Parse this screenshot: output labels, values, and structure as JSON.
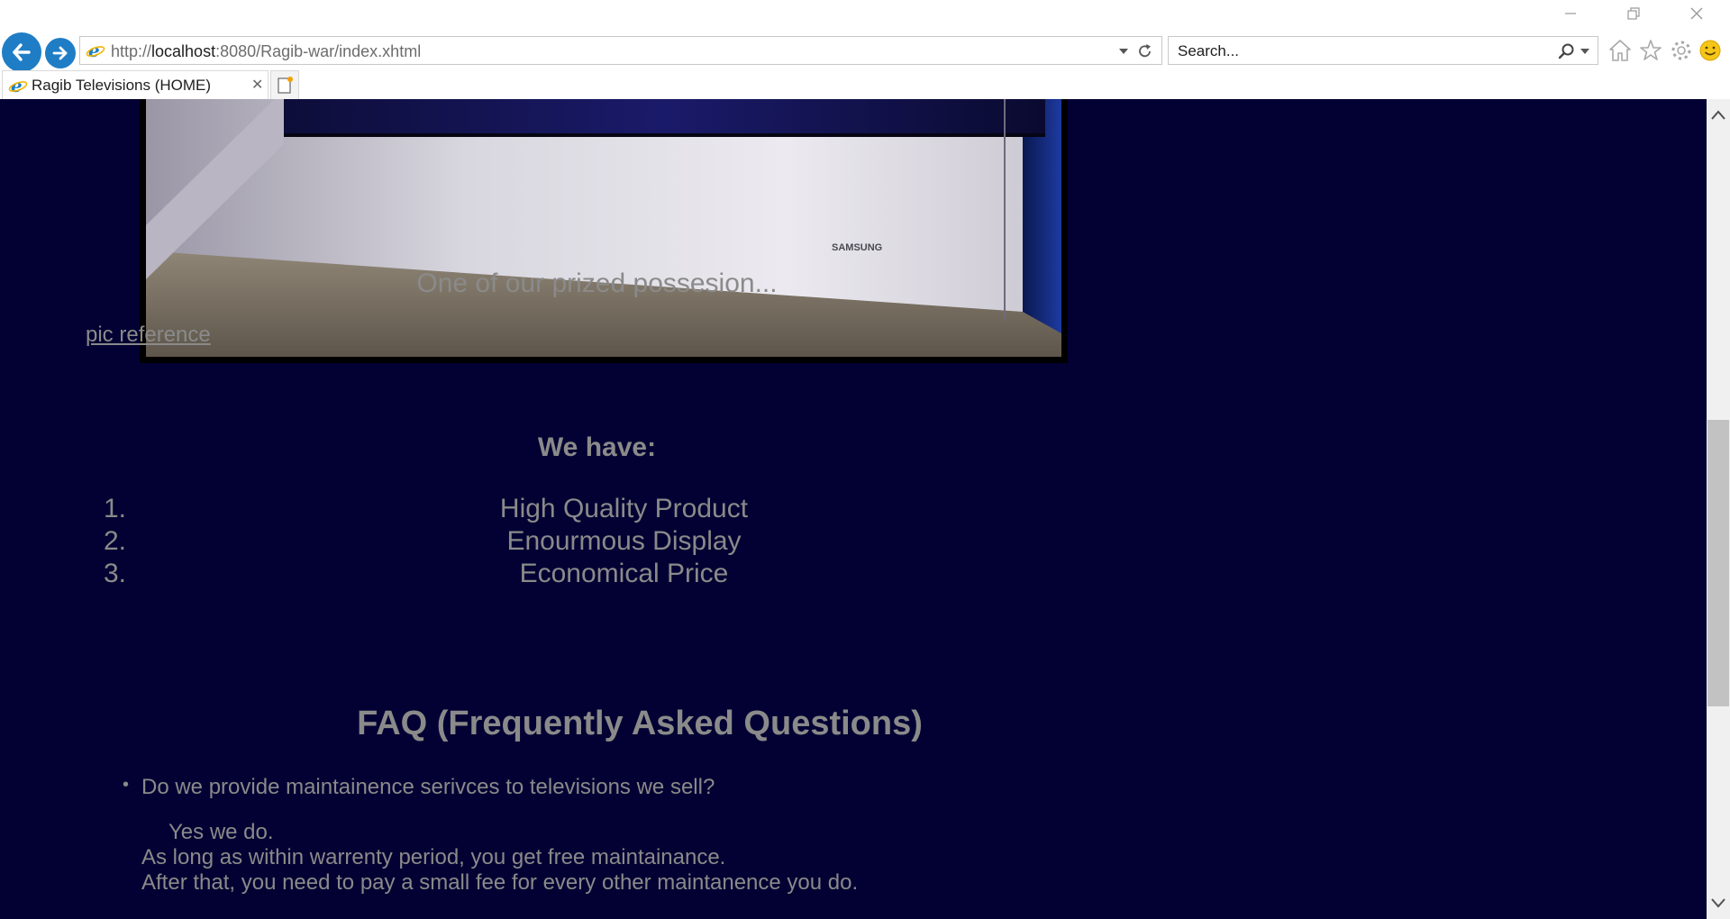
{
  "window": {
    "minimize_icon": "minimize-icon",
    "restore_icon": "restore-icon",
    "close_icon": "close-icon"
  },
  "navigation": {
    "back_icon": "back-arrow-icon",
    "forward_icon": "forward-arrow-icon",
    "address": {
      "prefix": "http://",
      "host": "localhost",
      "rest": ":8080/Ragib-war/index.xhtml"
    },
    "search": {
      "placeholder": "Search..."
    },
    "tools": [
      "home-icon",
      "favorites-star-icon",
      "settings-gear-icon",
      "feedback-smiley-icon"
    ]
  },
  "tabs": [
    {
      "title": "Ragib Televisions (HOME)",
      "active": true
    }
  ],
  "page": {
    "image_caption": "One of our prized possesion...",
    "pic_reference_link": "pic reference",
    "we_have_heading": "We have:",
    "features": [
      {
        "number": "1.",
        "text": "High Quality Product"
      },
      {
        "number": "2.",
        "text": "Enourmous Display"
      },
      {
        "number": "3.",
        "text": "Economical Price"
      }
    ],
    "faq_heading": "FAQ (Frequently Asked Questions)",
    "faq": [
      {
        "bullet": "•",
        "question": "Do we provide maintainence serivces to televisions we sell?",
        "answer_lines": [
          "Yes we do.",
          "As long as within warrenty period, you get free maintainance.",
          "After that, you need to pay a small fee for every other maintanence you do."
        ]
      }
    ],
    "tv_brand_mark": "SAMSUNG"
  },
  "colors": {
    "page_background": "#030133",
    "page_text": "#8a8a8a",
    "browser_accent": "#1f7dc6"
  }
}
